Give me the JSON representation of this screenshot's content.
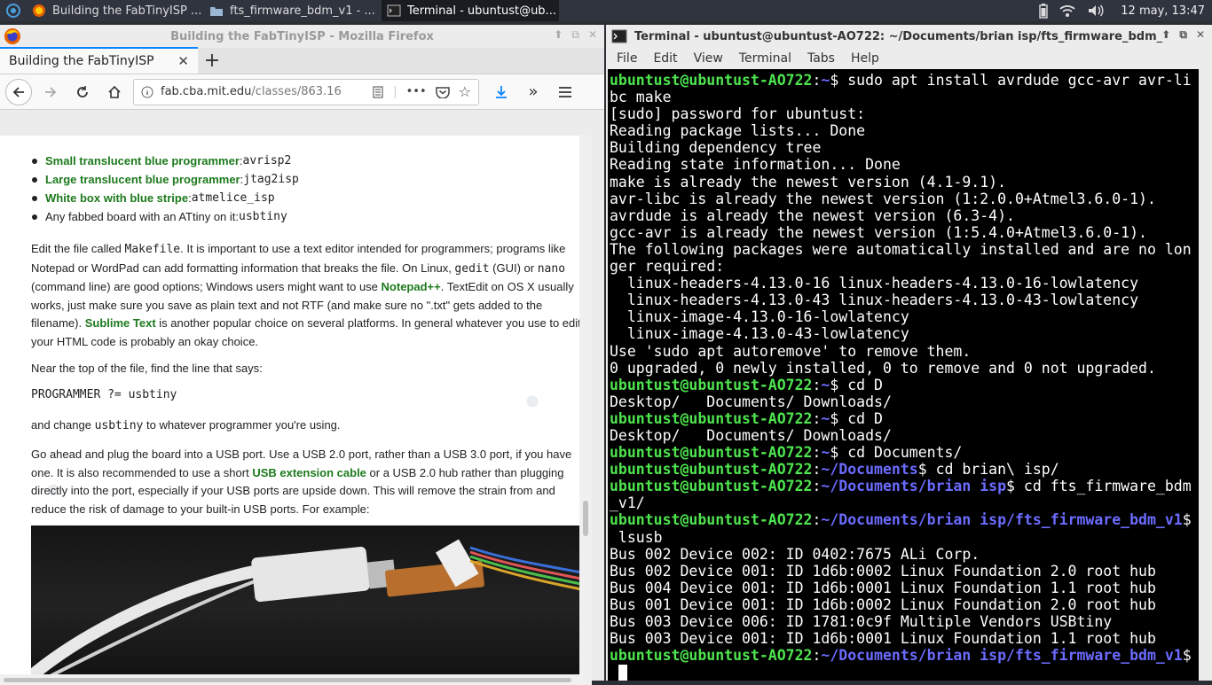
{
  "taskbar": {
    "tasks": [
      {
        "label": "Building the FabTinyISP ..."
      },
      {
        "label": "fts_firmware_bdm_v1 - ..."
      },
      {
        "label": "Terminal - ubuntust@ub..."
      }
    ],
    "clock": "12 may, 13:47"
  },
  "firefox": {
    "window_title": "Building the FabTinyISP - Mozilla Firefox",
    "tab_title": "Building the FabTinyISP",
    "url_host": "fab.cba.mit.edu",
    "url_path": "/classes/863.16",
    "bullets": [
      {
        "link": "Small translucent blue programmer",
        "sep": ": ",
        "code": "avrisp2"
      },
      {
        "link": "Large translucent blue programmer",
        "sep": ": ",
        "code": "jtag2isp"
      },
      {
        "link": "White box with blue stripe",
        "sep": ": ",
        "code": "atmelice_isp"
      },
      {
        "text": "Any fabbed board with an ATtiny on it: ",
        "code": "usbtiny"
      }
    ],
    "p1": {
      "a": "Edit the file called ",
      "code1": "Makefile",
      "b": ". It is important to use a text editor intended for programmers; programs like Notepad or WordPad can add formatting information that breaks the file. On Linux, ",
      "code2": "gedit",
      "c": " (GUI) or ",
      "code3": "nano",
      "d": " (command line) are good options; Windows users might want to use ",
      "link1": "Notepad++",
      "e": ". TextEdit on OS X usually works, just make sure you save as plain text and not RTF (and make sure no \".txt\" gets added to the filename). ",
      "link2": "Sublime Text",
      "f": " is another popular choice on several platforms. In general whatever you use to edit your HTML code is probably an okay choice."
    },
    "p2": "Near the top of the file, find the line that says:",
    "code_line": "PROGRAMMER ?= usbtiny",
    "p3": {
      "a": "and change ",
      "code": "usbtiny",
      "b": " to whatever programmer you're using."
    },
    "p4": {
      "a": "Go ahead and plug the board into a USB port. Use a USB 2.0 port, rather than a USB 3.0 port, if you have one. It is also recommended to use a short ",
      "link": "USB extension cable",
      "b": " or a USB 2.0 hub rather than plugging directly into the port, especially if your USB ports are upside down. This will remove the strain from and reduce the risk of damage to your built-in USB ports. For example:"
    }
  },
  "terminal": {
    "window_title": "Terminal - ubuntust@ubuntust-AO722: ~/Documents/brian isp/fts_firmware_bdm_",
    "menu": [
      "File",
      "Edit",
      "View",
      "Terminal",
      "Tabs",
      "Help"
    ],
    "lines": [
      {
        "user": "ubuntust@ubuntust-AO722",
        "path": "~",
        "cmd": "$ sudo apt install avrdude gcc-avr avr-li"
      },
      {
        "text": "bc make"
      },
      {
        "text": "[sudo] password for ubuntust:"
      },
      {
        "text": "Reading package lists... Done"
      },
      {
        "text": "Building dependency tree"
      },
      {
        "text": "Reading state information... Done"
      },
      {
        "text": "make is already the newest version (4.1-9.1)."
      },
      {
        "text": "avr-libc is already the newest version (1:2.0.0+Atmel3.6.0-1)."
      },
      {
        "text": "avrdude is already the newest version (6.3-4)."
      },
      {
        "text": "gcc-avr is already the newest version (1:5.4.0+Atmel3.6.0-1)."
      },
      {
        "text": "The following packages were automatically installed and are no lon"
      },
      {
        "text": "ger required:"
      },
      {
        "text": "  linux-headers-4.13.0-16 linux-headers-4.13.0-16-lowlatency"
      },
      {
        "text": "  linux-headers-4.13.0-43 linux-headers-4.13.0-43-lowlatency"
      },
      {
        "text": "  linux-image-4.13.0-16-lowlatency"
      },
      {
        "text": "  linux-image-4.13.0-43-lowlatency"
      },
      {
        "text": "Use 'sudo apt autoremove' to remove them."
      },
      {
        "text": "0 upgraded, 0 newly installed, 0 to remove and 0 not upgraded."
      },
      {
        "user": "ubuntust@ubuntust-AO722",
        "path": "~",
        "cmd": "$ cd D"
      },
      {
        "text": "Desktop/   Documents/ Downloads/"
      },
      {
        "user": "ubuntust@ubuntust-AO722",
        "path": "~",
        "cmd": "$ cd D"
      },
      {
        "text": "Desktop/   Documents/ Downloads/"
      },
      {
        "user": "ubuntust@ubuntust-AO722",
        "path": "~",
        "cmd": "$ cd Documents/"
      },
      {
        "user": "ubuntust@ubuntust-AO722",
        "path": "~/Documents",
        "cmd": "$ cd brian\\ isp/"
      },
      {
        "user": "ubuntust@ubuntust-AO722",
        "path": "~/Documents/brian isp",
        "cmd": "$ cd fts_firmware_bdm"
      },
      {
        "text": "_v1/"
      },
      {
        "user": "ubuntust@ubuntust-AO722",
        "path": "~/Documents/brian isp/fts_firmware_bdm_v1",
        "cmd": "$"
      },
      {
        "text": " lsusb"
      },
      {
        "text": "Bus 002 Device 002: ID 0402:7675 ALi Corp."
      },
      {
        "text": "Bus 002 Device 001: ID 1d6b:0002 Linux Foundation 2.0 root hub"
      },
      {
        "text": "Bus 004 Device 001: ID 1d6b:0001 Linux Foundation 1.1 root hub"
      },
      {
        "text": "Bus 001 Device 001: ID 1d6b:0002 Linux Foundation 2.0 root hub"
      },
      {
        "text": "Bus 003 Device 006: ID 1781:0c9f Multiple Vendors USBtiny"
      },
      {
        "text": "Bus 003 Device 001: ID 1d6b:0001 Linux Foundation 1.1 root hub"
      },
      {
        "user": "ubuntust@ubuntust-AO722",
        "path": "~/Documents/brian isp/fts_firmware_bdm_v1",
        "cmd": "$"
      }
    ]
  }
}
